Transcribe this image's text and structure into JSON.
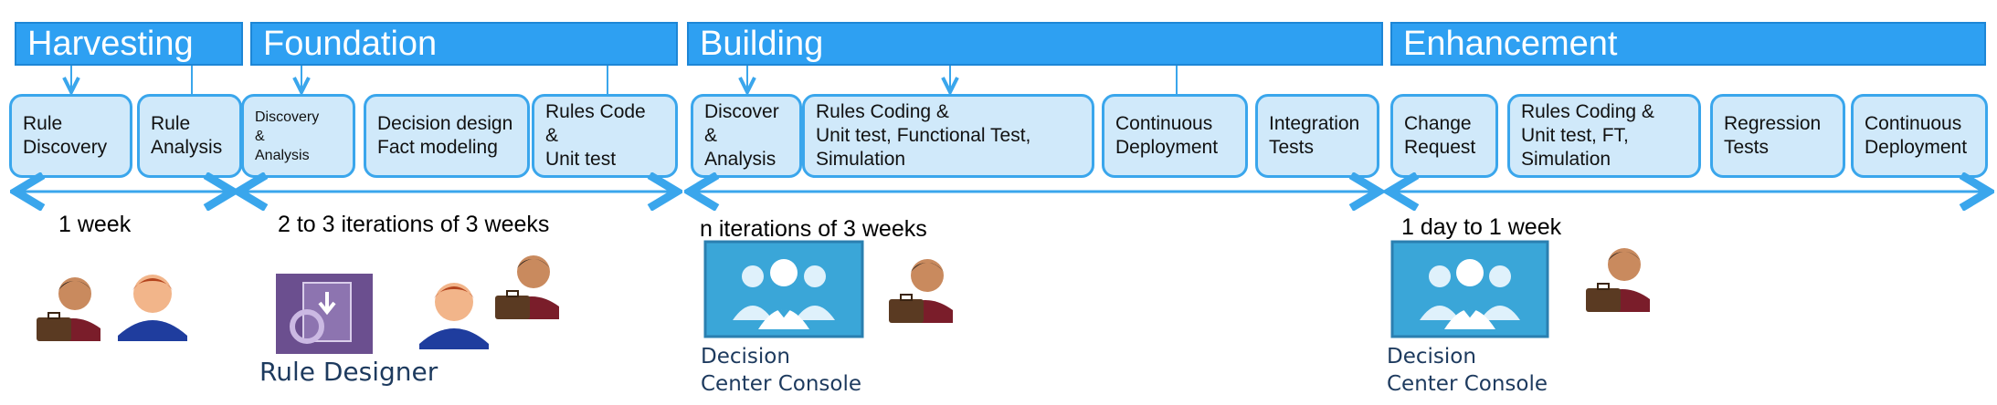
{
  "phases": [
    {
      "name": "Harvesting"
    },
    {
      "name": "Foundation"
    },
    {
      "name": "Building"
    },
    {
      "name": "Enhancement"
    }
  ],
  "steps": [
    {
      "label": "Rule\nDiscovery"
    },
    {
      "label": "Rule\nAnalysis"
    },
    {
      "label": "Discovery\n&\nAnalysis"
    },
    {
      "label": "Decision design\nFact modeling"
    },
    {
      "label": "Rules Code\n&\nUnit test"
    },
    {
      "label": "Discover\n&\nAnalysis"
    },
    {
      "label": "Rules Coding &\nUnit test, Functional Test,\nSimulation"
    },
    {
      "label": "Continuous\nDeployment"
    },
    {
      "label": "Integration\nTests"
    },
    {
      "label": "Change\nRequest"
    },
    {
      "label": "Rules Coding &\nUnit test, FT,\nSimulation"
    },
    {
      "label": "Regression\nTests"
    },
    {
      "label": "Continuous\nDeployment"
    }
  ],
  "durations": [
    {
      "text": "1 week"
    },
    {
      "text": "2 to 3 iterations of 3 weeks"
    },
    {
      "text": "n iterations of 3 weeks"
    },
    {
      "text": "1 day to 1 week"
    }
  ],
  "tools": [
    {
      "label": "Rule Designer"
    },
    {
      "label": "Decision\nCenter Console"
    },
    {
      "label": "Decision\nCenter Console"
    }
  ],
  "colors": {
    "header_blue": "#2ea0f2",
    "step_fill": "#d0e9fa",
    "step_border": "#3aa6ec",
    "arrow": "#3aa6ec"
  }
}
